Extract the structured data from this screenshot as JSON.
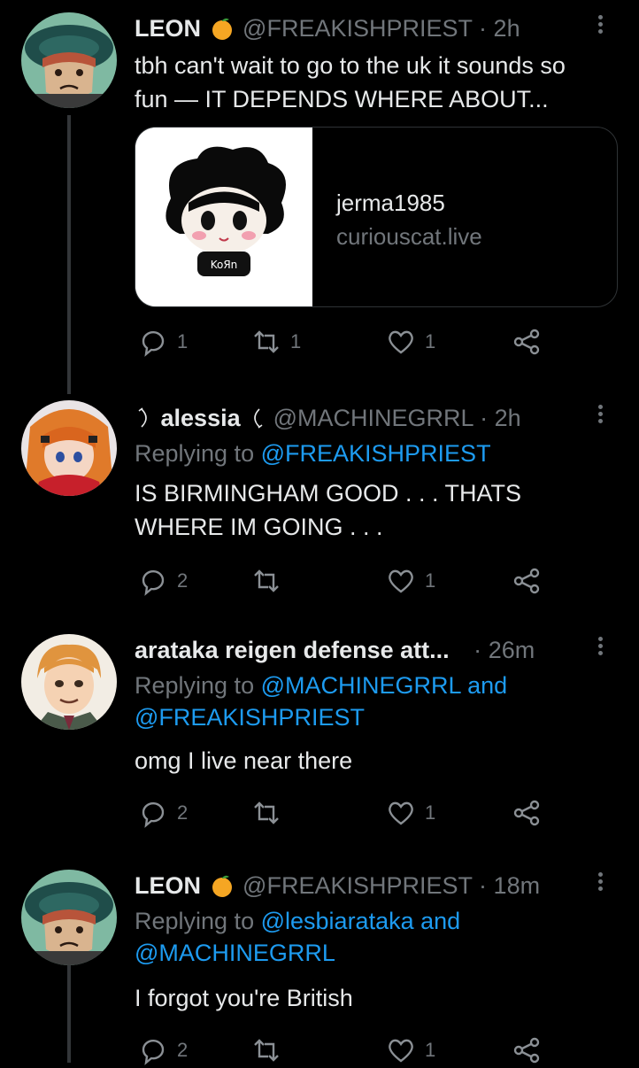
{
  "tweets": [
    {
      "name": "LEON",
      "handle": "@FREAKISHPRIEST",
      "time": "2h",
      "text": "tbh can't wait to go to the uk it sounds so fun — IT DEPENDS WHERE ABOUT...",
      "card": {
        "title": "jerma1985",
        "domain": "curiouscat.live"
      },
      "replies": "1",
      "retweets": "1",
      "likes": "1"
    },
    {
      "name": "alessia",
      "handle": "@MACHINEGRRL",
      "time": "2h",
      "replying_prefix": "Replying to",
      "mentions": [
        "@FREAKISHPRIEST"
      ],
      "text": "IS BIRMINGHAM GOOD . . . THATS WHERE IM GOING . . .",
      "replies": "2",
      "retweets": "",
      "likes": "1"
    },
    {
      "name": "arataka reigen defense att...",
      "handle": "",
      "time": "26m",
      "replying_prefix": "Replying to",
      "mentions": [
        "@MACHINEGRRL",
        "@FREAKISHPRIEST"
      ],
      "joiner": "and",
      "text": "omg I live near there",
      "replies": "2",
      "retweets": "",
      "likes": "1"
    },
    {
      "name": "LEON",
      "handle": "@FREAKISHPRIEST",
      "time": "18m",
      "replying_prefix": "Replying to",
      "mentions": [
        "@lesbiarataka",
        "@MACHINEGRRL"
      ],
      "joiner": "and",
      "text": "I forgot you're British",
      "replies": "2",
      "retweets": "",
      "likes": "1"
    }
  ],
  "separator": "·",
  "icons": [
    "reply-icon",
    "retweet-icon",
    "like-icon",
    "share-icon",
    "more-icon",
    "orange-emoji",
    "moon-icon"
  ],
  "colors": {
    "background": "#000000",
    "text": "#e7e9ea",
    "muted": "#71767b",
    "link": "#1d9bf0",
    "orange": "#f5a623"
  }
}
